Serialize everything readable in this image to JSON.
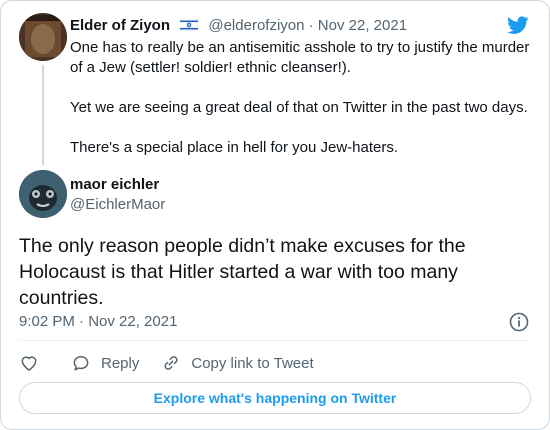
{
  "quoted_tweet": {
    "author_name": "Elder of Ziyon",
    "flag_icon": "israel-flag-icon",
    "handle": "@elderofziyon",
    "date": "· Nov 22, 2021",
    "paragraphs": [
      "One has to really be an antisemitic asshole to try to justify the murder of a Jew (settler! soldier! ethnic cleanser!).",
      "Yet we are seeing a great deal of that on Twitter in the past two days.",
      "There's a special place in hell for you Jew-haters."
    ]
  },
  "tweet": {
    "author_name": "maor eichler",
    "handle": "@EichlerMaor",
    "text": "The only reason people didn’t make excuses for the Holocaust is that Hitler started a war with too many countries.",
    "timestamp": "9:02 PM · Nov 22, 2021"
  },
  "actions": {
    "like_icon": "heart-icon",
    "reply_label": "Reply",
    "copy_link_label": "Copy link to Tweet"
  },
  "explore_label": "Explore what's happening on Twitter",
  "colors": {
    "accent": "#1d9bf0",
    "secondary_text": "#536471",
    "border": "#cfd9de"
  }
}
